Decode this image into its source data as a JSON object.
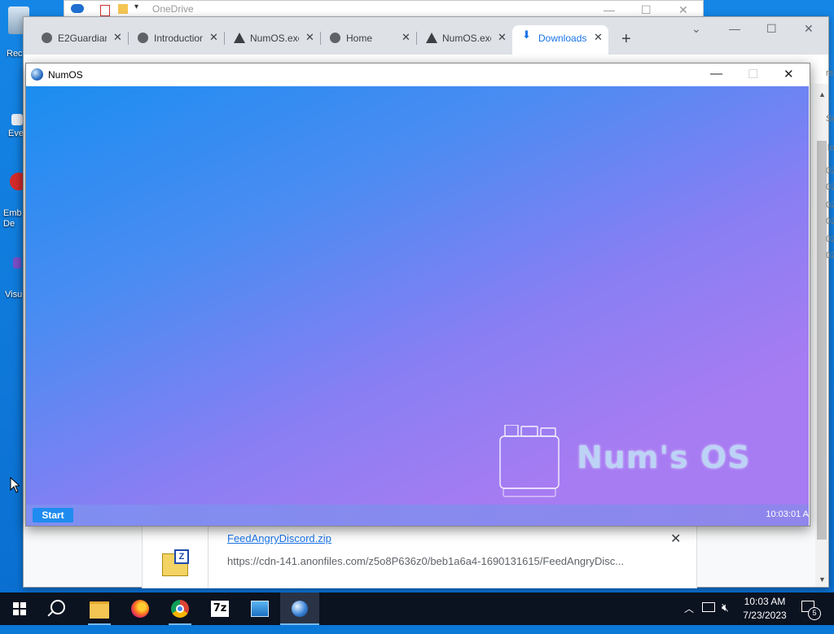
{
  "desktop": {
    "icons": [
      {
        "label": "Rec"
      },
      {
        "label": "Eve"
      },
      {
        "label": "Emb\nDe"
      },
      {
        "label": "Visu"
      }
    ]
  },
  "background_explorer": {
    "title": "OneDrive"
  },
  "chrome": {
    "tabs": [
      {
        "title": "E2Guardian"
      },
      {
        "title": "Introduction"
      },
      {
        "title": "NumOS.exe"
      },
      {
        "title": "Home"
      },
      {
        "title": "NumOS.exe"
      },
      {
        "title": "Downloads"
      }
    ],
    "download": {
      "filename": "FeedAngryDiscord.zip",
      "url": "https://cdn-141.anonfiles.com/z5o8P636z0/beb1a6a4-1690131615/FeedAngryDisc..."
    },
    "edge_fragments": [
      "rs",
      "Se",
      "lo",
      "02",
      "02",
      "02",
      "02",
      "02",
      "02"
    ]
  },
  "numos_window": {
    "title": "NumOS",
    "logo_text": "Num's OS",
    "start_label": "Start",
    "clock": "10:03:01 A"
  },
  "taskbar": {
    "time": "10:03 AM",
    "date": "7/23/2023",
    "notification_count": "5",
    "apps": [
      "start",
      "search",
      "file-explorer",
      "firefox",
      "chrome",
      "7zip",
      "photos",
      "numos"
    ]
  }
}
